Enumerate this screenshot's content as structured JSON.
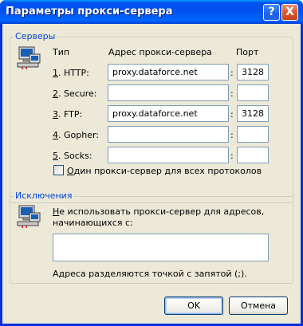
{
  "window": {
    "title": "Параметры прокси-сервера",
    "help_button": "?",
    "close_button": "X"
  },
  "servers": {
    "legend": "Серверы",
    "col_type": "Тип",
    "col_address": "Адрес прокси-сервера",
    "col_port": "Порт",
    "rows": [
      {
        "num": "1",
        "label": ". HTTP:",
        "address": "proxy.dataforce.net",
        "port": "3128"
      },
      {
        "num": "2",
        "label": ". Secure:",
        "address": "",
        "port": ""
      },
      {
        "num": "3",
        "label": ". FTP:",
        "address": "proxy.dataforce.net",
        "port": "3128"
      },
      {
        "num": "4",
        "label": ". Gopher:",
        "address": "",
        "port": ""
      },
      {
        "num": "5",
        "label": ". Socks:",
        "address": "",
        "port": ""
      }
    ],
    "colon": ":",
    "same_proxy_first": "О",
    "same_proxy_rest": "дин прокси-сервер для всех протоколов",
    "same_proxy_checked": false
  },
  "exceptions": {
    "legend": "Исключения",
    "desc_first": "Н",
    "desc_line1_rest": "е использовать прокси-сервер для адресов,",
    "desc_line2": "начинающихся с:",
    "value": "",
    "hint": "Адреса разделяются точкой с запятой (;)."
  },
  "buttons": {
    "ok": "OK",
    "cancel": "Отмена"
  },
  "colors": {
    "titlebar": "#0054e3",
    "group_legend": "#0046d5",
    "dialog_bg": "#ece9d8"
  }
}
